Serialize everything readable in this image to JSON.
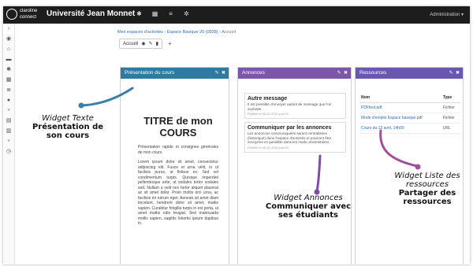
{
  "topbar": {
    "logo_text": "claroline connect",
    "university": "Université Jean Monnet",
    "admin_label": "Administration ▾",
    "icons": [
      "home-icon",
      "gear-icon",
      "calendar-icon",
      "list-icon",
      "settings-icon"
    ]
  },
  "sidebar": {
    "icons": [
      "expand-icon",
      "eye-icon",
      "home-icon",
      "folder-icon",
      "gear-icon",
      "calendar-icon",
      "list-icon",
      "user-icon",
      "trophy-icon",
      "grid-icon",
      "chart-icon",
      "award-icon",
      "clock-icon"
    ]
  },
  "breadcrumb": {
    "part1": "Mes espaces d'activités",
    "sep1": " › ",
    "part2": "Espace Basique 20 (0928)",
    "sep2": " › ",
    "part3": "Accueil"
  },
  "tabs": {
    "active_tab": "Accueil",
    "add_symbol": "+"
  },
  "widget_text": {
    "header": "Présentation du cours",
    "title_line1": "TITRE de mon",
    "title_line2": "COURS",
    "intro": "Présentation rapide et consignes générales de mon cours.",
    "lorem": "Lorem ipsum dolor sit amet, consectetur adipiscing elit. Fusce et urna velit, in ut facilisis purus, ut finibus ex. Sed vel condimentum turpis. Quisque imperdiet pellentesque ante, ut sodales tortor sodales sed. Nullam a velit nec tortor aliquet placerat ac sit amet dolor. Proin mollis orci urna, ac facilisis mi rutrum eget. Aenean sit amet diam tincidunt, hendrerit dolor sit amet, mattis sapien. Curabitur fringilla turpis in est porta, ut amet mattis odio feugiat. Sed malesuada mollis sapien, sagittis lobortis ipsum dapibus in."
  },
  "widget_annonces": {
    "header": "Annonces",
    "items": [
      {
        "title": "Autre message",
        "body": "Il est possible d'envoyer autant de message que l'on souhaite",
        "date": "Publiée le 05-01-2021 par Eli"
      },
      {
        "title": "Communiquer par les annonces",
        "body": "Les annonces communiquées seront centralisées (historique) dans l'espace d'activités et pourront être envoyées en parallèle dans les mails universitaires.",
        "date": "Publiée le 05-01-2021 par Eli"
      }
    ]
  },
  "widget_ressources": {
    "header": "Ressources",
    "columns": [
      "Nom",
      "Type"
    ],
    "rows": [
      {
        "name": "PDFtest.pdf",
        "type": "Fichier"
      },
      {
        "name": "Mode d'emploi Espace basique.pdf",
        "type": "Fichier"
      },
      {
        "name": "Cours du 12 avril, 14h00",
        "type": "URL"
      }
    ]
  },
  "callouts": {
    "texte": {
      "line1": "Widget Texte",
      "line2": "Présentation de",
      "line3": "son cours"
    },
    "annonces": {
      "line1": "Widget Annonces",
      "line2": "Communiquer avec",
      "line3": "ses étudiants"
    },
    "ressources": {
      "line1": "Widget Liste des",
      "line2": "ressources",
      "line3": "Partager des",
      "line4": "ressources"
    }
  },
  "colors": {
    "texte_widget": "#2f7aa0",
    "annonces_widget": "#7c56a8",
    "ressources_widget": "#6a57b0",
    "callout_texte_line": "#3b7fa6",
    "callout_annonces_line": "#7b4fa5",
    "callout_ressources_line": "#a0509a"
  }
}
